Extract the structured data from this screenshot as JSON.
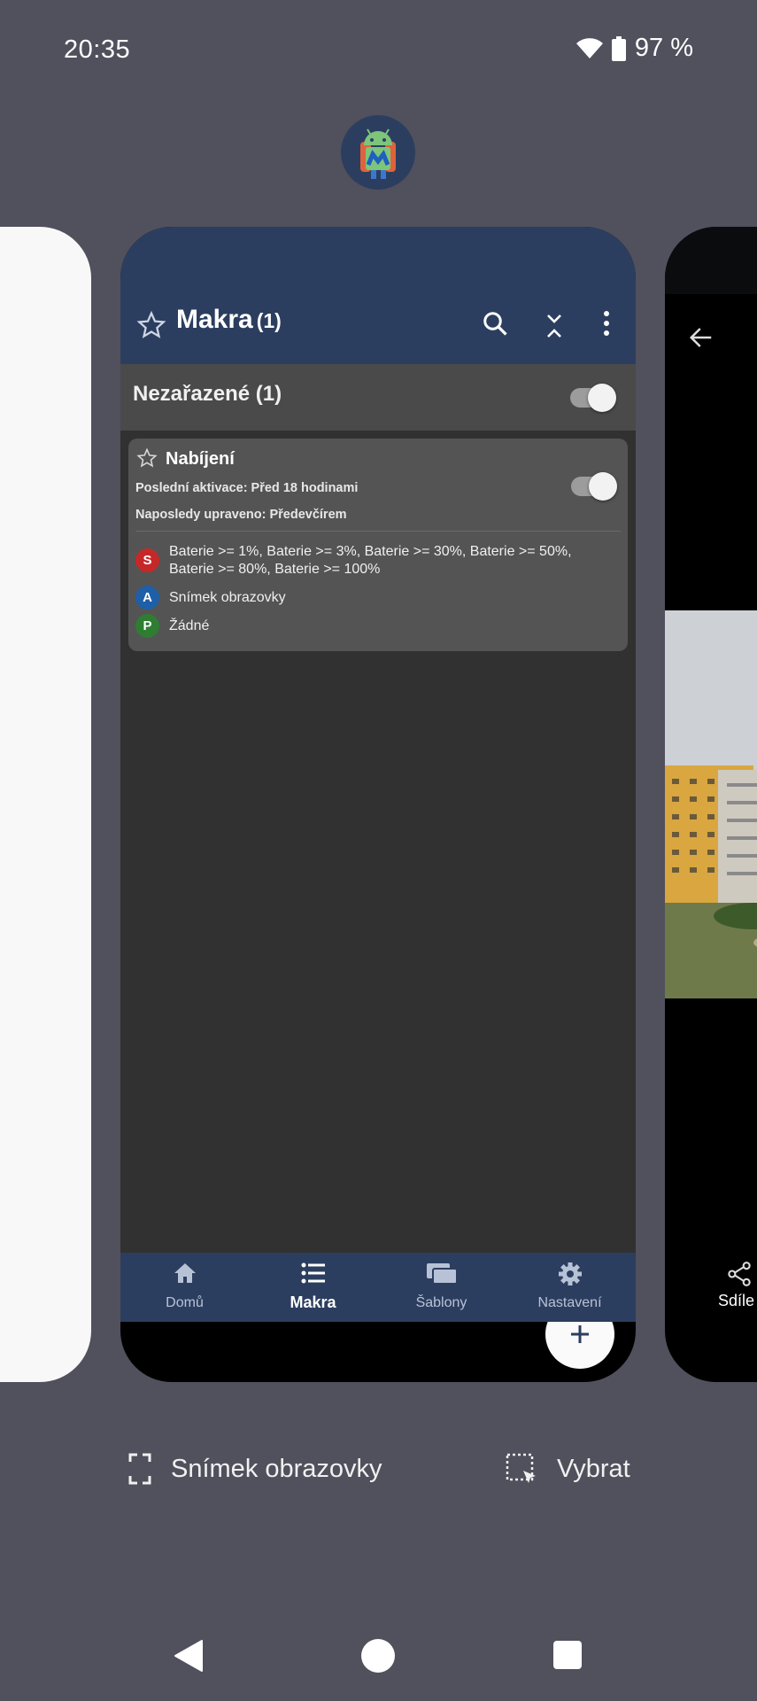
{
  "status_bar": {
    "time": "20:35",
    "battery": "97 %",
    "icons": [
      "wifi-icon",
      "battery-icon"
    ]
  },
  "app_icon": "macrodroid-app-icon",
  "app": {
    "title": "Makra",
    "title_count": "(1)",
    "toolbar_icons": [
      "star-icon",
      "search-icon",
      "collapse-icon",
      "more-vert-icon"
    ],
    "category": {
      "title": "Nezařazené (1)",
      "enabled": true
    },
    "macro": {
      "name": "Nabíjení",
      "last_activation": "Poslední aktivace: Před 18 hodinami",
      "last_edited": "Naposledy upraveno: Předevčírem",
      "enabled": true,
      "rows": [
        {
          "badge": "S",
          "color": "#c62828",
          "text": "Baterie >= 1%, Baterie >= 3%, Baterie >= 30%, Baterie >= 50%, Baterie >= 80%, Baterie >= 100%"
        },
        {
          "badge": "A",
          "color": "#1e5fa8",
          "text": "Snímek obrazovky"
        },
        {
          "badge": "P",
          "color": "#2e7d32",
          "text": "Žádné"
        }
      ]
    },
    "fab_icon": "plus-icon",
    "bottom_nav": [
      {
        "label": "Domů",
        "icon": "home-icon",
        "active": false
      },
      {
        "label": "Makra",
        "icon": "list-icon",
        "active": true
      },
      {
        "label": "Šablony",
        "icon": "templates-icon",
        "active": false
      },
      {
        "label": "Nastavení",
        "icon": "gear-icon",
        "active": false
      }
    ]
  },
  "right_card": {
    "share_label": "Sdíle"
  },
  "recents_actions": {
    "screenshot_label": "Snímek obrazovky",
    "select_label": "Vybrat"
  },
  "colors": {
    "app_primary": "#2c3e5f",
    "background": "#51505d",
    "content_bg": "#313131",
    "card_bg": "#545454"
  }
}
